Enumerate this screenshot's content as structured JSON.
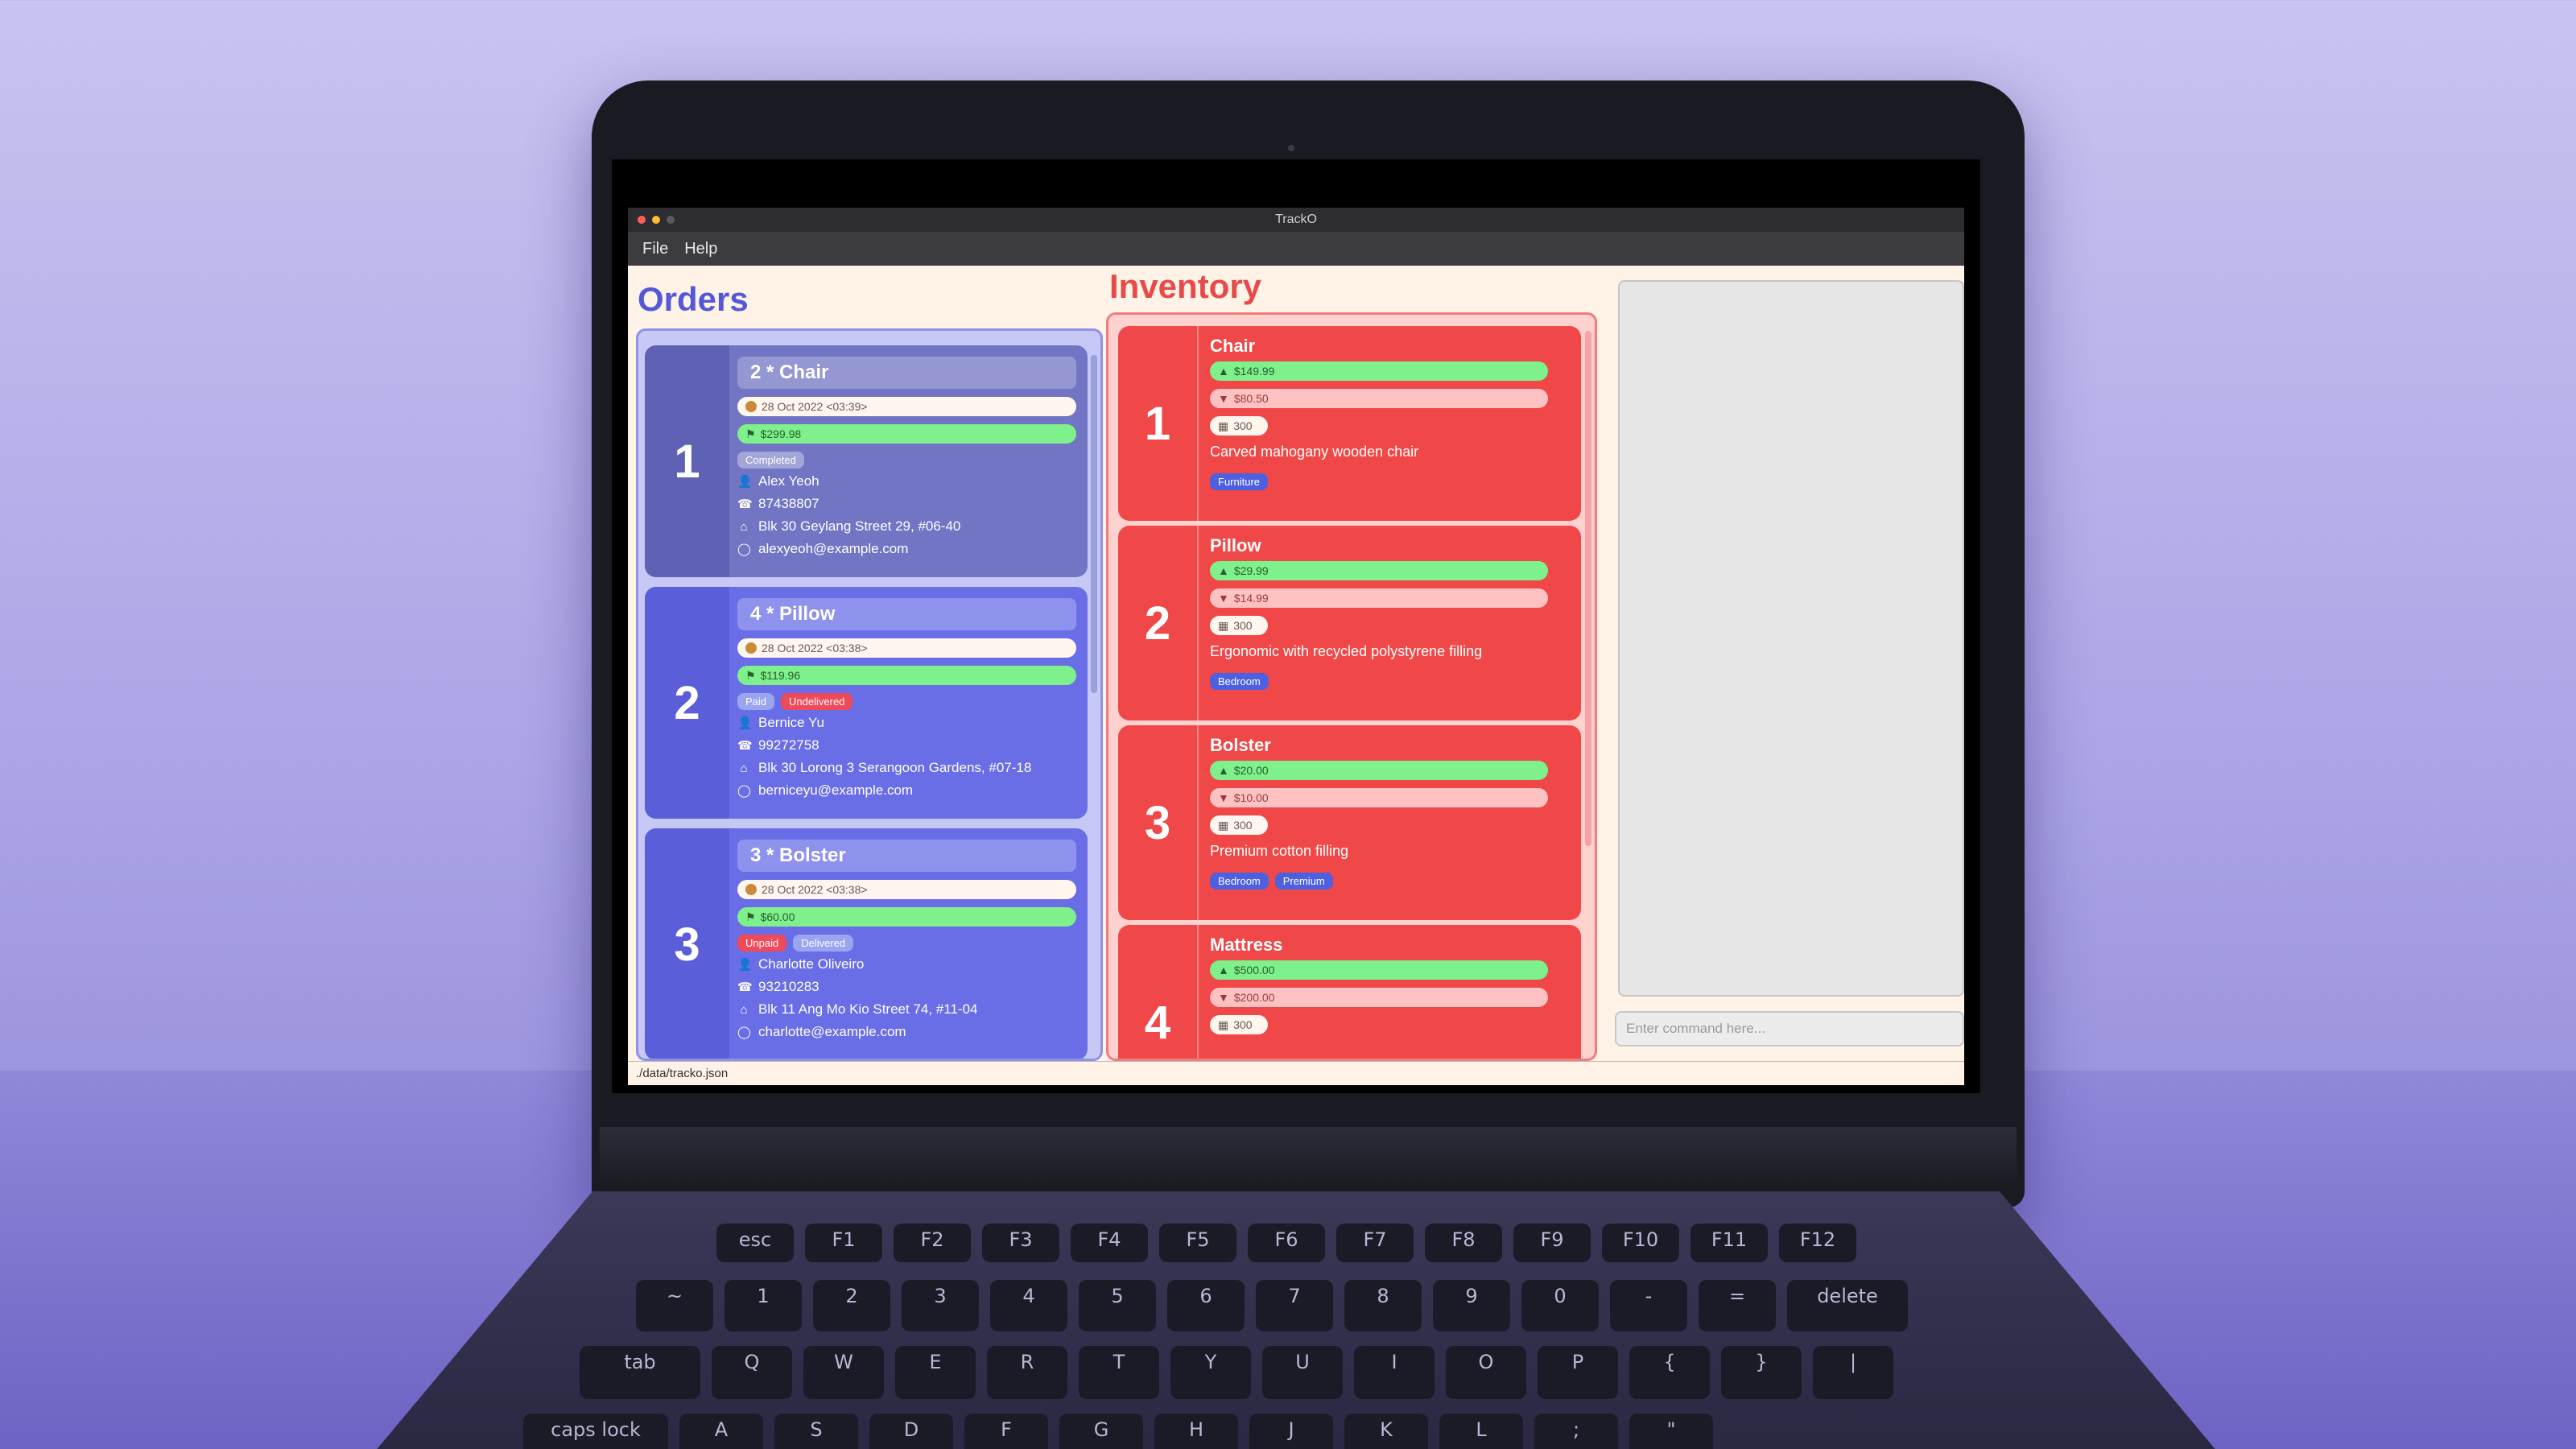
{
  "window": {
    "title": "TrackO"
  },
  "menu": {
    "file": "File",
    "help": "Help"
  },
  "orders": {
    "title": "Orders",
    "items": [
      {
        "index": "1",
        "item": "2 * Chair",
        "date": "28 Oct 2022 <03:39>",
        "price": "$299.98",
        "tags": [
          "Completed"
        ],
        "name": "Alex Yeoh",
        "phone": "87438807",
        "address": "Blk 30 Geylang Street 29, #06-40",
        "email": "alexyeoh@example.com"
      },
      {
        "index": "2",
        "item": "4 * Pillow",
        "date": "28 Oct 2022 <03:38>",
        "price": "$119.96",
        "tags": [
          "Paid",
          "Undelivered"
        ],
        "name": "Bernice Yu",
        "phone": "99272758",
        "address": "Blk 30 Lorong 3 Serangoon Gardens, #07-18",
        "email": "berniceyu@example.com"
      },
      {
        "index": "3",
        "item": "3 * Bolster",
        "date": "28 Oct 2022 <03:38>",
        "price": "$60.00",
        "tags": [
          "Unpaid",
          "Delivered"
        ],
        "name": "Charlotte Oliveiro",
        "phone": "93210283",
        "address": "Blk 11 Ang Mo Kio Street 74, #11-04",
        "email": "charlotte@example.com"
      }
    ]
  },
  "inventory": {
    "title": "Inventory",
    "items": [
      {
        "index": "1",
        "name": "Chair",
        "sell": "$149.99",
        "cost": "$80.50",
        "qty": "300",
        "description": "Carved mahogany wooden chair",
        "tags": [
          "Furniture"
        ]
      },
      {
        "index": "2",
        "name": "Pillow",
        "sell": "$29.99",
        "cost": "$14.99",
        "qty": "300",
        "description": "Ergonomic with recycled polystyrene filling",
        "tags": [
          "Bedroom"
        ]
      },
      {
        "index": "3",
        "name": "Bolster",
        "sell": "$20.00",
        "cost": "$10.00",
        "qty": "300",
        "description": "Premium cotton filling",
        "tags": [
          "Bedroom",
          "Premium"
        ]
      },
      {
        "index": "4",
        "name": "Mattress",
        "sell": "$500.00",
        "cost": "$200.00",
        "qty": "300",
        "description": "",
        "tags": []
      }
    ]
  },
  "command": {
    "placeholder": "Enter command here..."
  },
  "status": {
    "path": "./data/tracko.json"
  },
  "keyboard": {
    "fn_row": [
      "esc",
      "F1",
      "F2",
      "F3",
      "F4",
      "F5",
      "F6",
      "F7",
      "F8",
      "F9",
      "F10",
      "F11",
      "F12"
    ],
    "num_row": [
      "~",
      "1",
      "2",
      "3",
      "4",
      "5",
      "6",
      "7",
      "8",
      "9",
      "0",
      "-",
      "=",
      "delete"
    ],
    "qwerty_row": [
      "tab",
      "Q",
      "W",
      "E",
      "R",
      "T",
      "Y",
      "U",
      "I",
      "O",
      "P",
      "{",
      "}",
      "|"
    ],
    "home_row": [
      "caps lock",
      "A",
      "S",
      "D",
      "F",
      "G",
      "H",
      "J",
      "K",
      "L",
      ";",
      "\""
    ]
  },
  "colors": {
    "orders_accent": "#5458d8",
    "inventory_accent": "#e84a4a",
    "app_bg": "#fff2e6",
    "order_card_selected": "#7275c4",
    "order_card": "#6a6ee6"
  }
}
